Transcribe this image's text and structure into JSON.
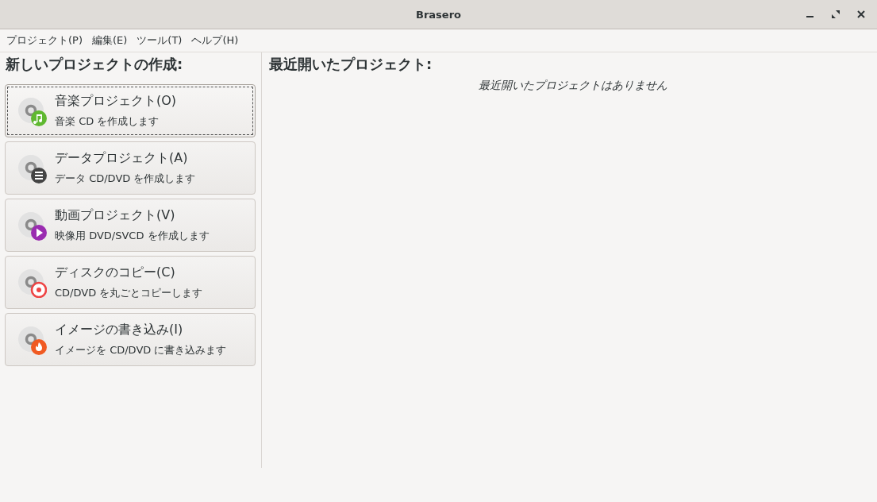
{
  "window": {
    "title": "Brasero"
  },
  "menu": [
    "プロジェクト(P)",
    "編集(E)",
    "ツール(T)",
    "ヘルプ(H)"
  ],
  "new_project": {
    "heading": "新しいプロジェクトの作成:",
    "items": [
      {
        "kind": "music",
        "title": "音楽プロジェクト(O)",
        "subtitle": "音楽 CD を作成します",
        "focused": true,
        "color": "#5fb830"
      },
      {
        "kind": "data",
        "title": "データプロジェクト(A)",
        "subtitle": "データ CD/DVD を作成します",
        "focused": false,
        "color": "#444444"
      },
      {
        "kind": "video",
        "title": "動画プロジェクト(V)",
        "subtitle": "映像用 DVD/SVCD を作成します",
        "focused": false,
        "color": "#9a2cb0"
      },
      {
        "kind": "copy",
        "title": "ディスクのコピー(C)",
        "subtitle": "CD/DVD を丸ごとコピーします",
        "focused": false,
        "color": "#ee4444"
      },
      {
        "kind": "burn",
        "title": "イメージの書き込み(I)",
        "subtitle": "イメージを CD/DVD に書き込みます",
        "focused": false,
        "color": "#f05a22"
      }
    ]
  },
  "recent": {
    "heading": "最近開いたプロジェクト:",
    "empty_message": "最近開いたプロジェクトはありません"
  }
}
